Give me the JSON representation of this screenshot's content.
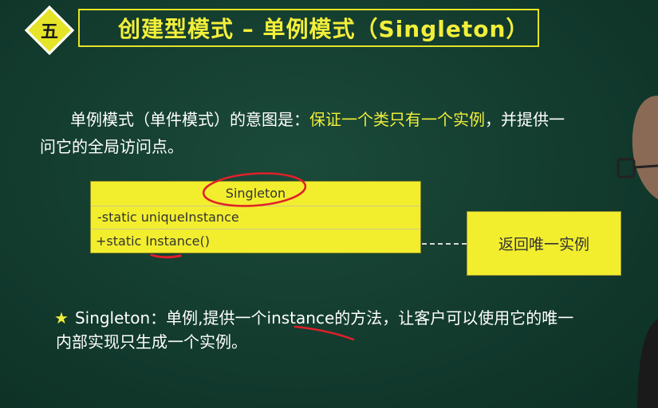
{
  "header": {
    "badge": "五",
    "title": "创建型模式 – 单例模式（Singleton）"
  },
  "intro": {
    "line1_prefix": "单例模式（单件模式）的意图是：",
    "line1_highlight": "保证一个类只有一个实例",
    "line1_suffix": "，并提供一",
    "line2": "问它的全局访问点。"
  },
  "uml": {
    "class_name": "Singleton",
    "attribute": "-static uniqueInstance",
    "operation": "+static Instance()"
  },
  "note": {
    "text": "返回唯一实例"
  },
  "bullet": {
    "star": "★",
    "line1": "Singleton：单例,提供一个instance的方法，让客户可以使用它的唯一",
    "line2": "内部实现只生成一个实例。"
  },
  "colors": {
    "background": "#143d30",
    "accent_yellow": "#f2ee2e",
    "annotation_red": "#e0202a"
  }
}
